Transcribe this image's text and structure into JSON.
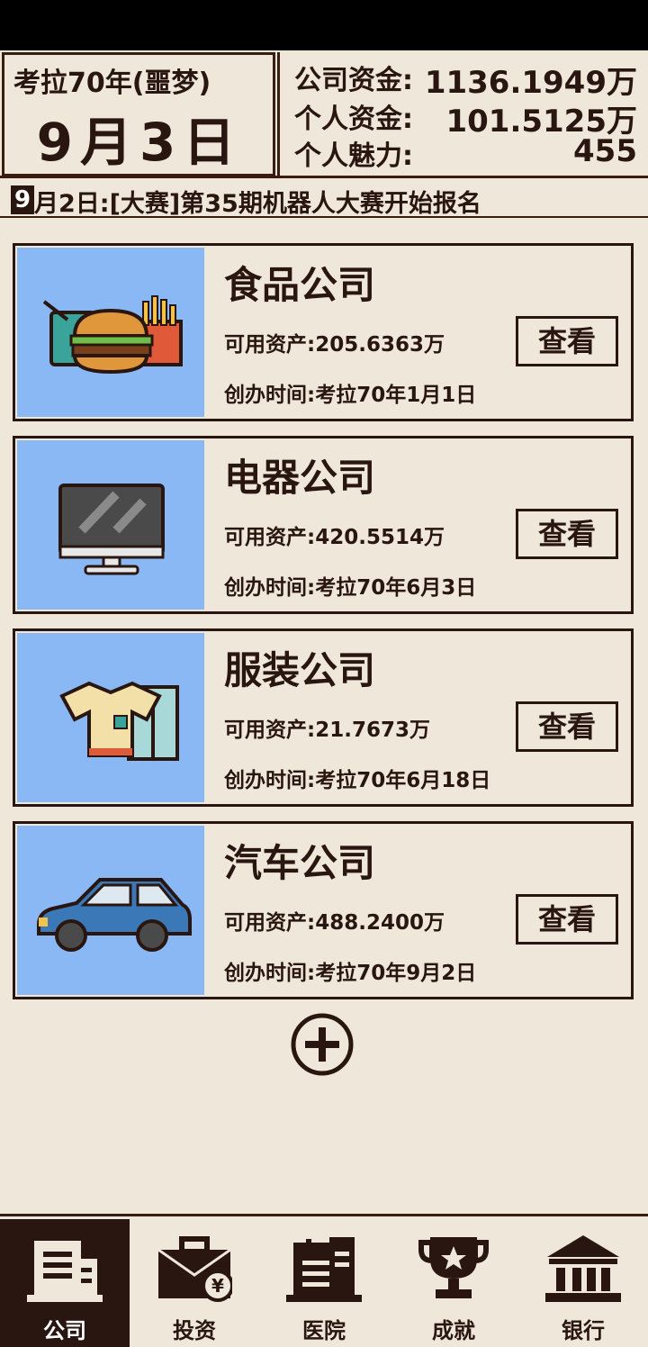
{
  "header": {
    "year_label": "考拉70年(噩梦)",
    "big_date": "9月3日",
    "company_funds_label": "公司资金:",
    "company_funds_value": "1136.1949万",
    "personal_funds_label": "个人资金:",
    "personal_funds_value": "101.5125万",
    "charisma_label": "个人魅力:",
    "charisma_value": "455"
  },
  "ticker": {
    "day": "9",
    "message": "月2日:[大赛]第35期机器人大赛开始报名"
  },
  "companies": [
    {
      "name": "食品公司",
      "assets": "可用资产:205.6363万",
      "founded": "创办时间:考拉70年1月1日",
      "view_label": "查看",
      "icon": "food-icon"
    },
    {
      "name": "电器公司",
      "assets": "可用资产:420.5514万",
      "founded": "创办时间:考拉70年6月3日",
      "view_label": "查看",
      "icon": "monitor-icon"
    },
    {
      "name": "服装公司",
      "assets": "可用资产:21.7673万",
      "founded": "创办时间:考拉70年6月18日",
      "view_label": "查看",
      "icon": "clothes-icon"
    },
    {
      "name": "汽车公司",
      "assets": "可用资产:488.2400万",
      "founded": "创办时间:考拉70年9月2日",
      "view_label": "查看",
      "icon": "car-icon"
    }
  ],
  "tabs": [
    {
      "label": "公司",
      "icon": "building-icon",
      "active": true
    },
    {
      "label": "投资",
      "icon": "briefcase-icon",
      "active": false
    },
    {
      "label": "医院",
      "icon": "hospital-icon",
      "active": false
    },
    {
      "label": "成就",
      "icon": "trophy-icon",
      "active": false
    },
    {
      "label": "银行",
      "icon": "bank-icon",
      "active": false
    }
  ],
  "colors": {
    "background": "#efe8da",
    "ink": "#2a1610",
    "thumb_bg": "#8ab8f5"
  }
}
